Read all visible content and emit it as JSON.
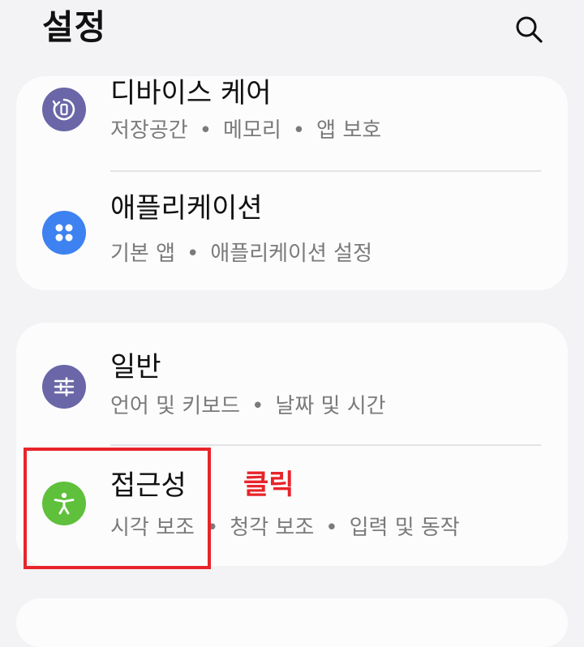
{
  "header": {
    "title": "설정",
    "search_icon": "search-icon"
  },
  "groups": [
    {
      "items": [
        {
          "title": "디바이스 케어",
          "subtitle": [
            "저장공간",
            "메모리",
            "앱 보호"
          ],
          "icon": "device-care-icon",
          "icon_color": "#6a66a7"
        },
        {
          "title": "애플리케이션",
          "subtitle": [
            "기본 앱",
            "애플리케이션 설정"
          ],
          "icon": "apps-grid-icon",
          "icon_color": "#3d82f0"
        }
      ]
    },
    {
      "items": [
        {
          "title": "일반",
          "subtitle": [
            "언어 및 키보드",
            "날짜 및 시간"
          ],
          "icon": "sliders-icon",
          "icon_color": "#6a66a7"
        },
        {
          "title": "접근성",
          "subtitle": [
            "시각 보조",
            "청각 보조",
            "입력 및 동작"
          ],
          "icon": "accessibility-icon",
          "icon_color": "#5fc03b"
        }
      ]
    }
  ],
  "separator": "•",
  "annotation": {
    "text": "클릭",
    "color": "#e8242a"
  }
}
